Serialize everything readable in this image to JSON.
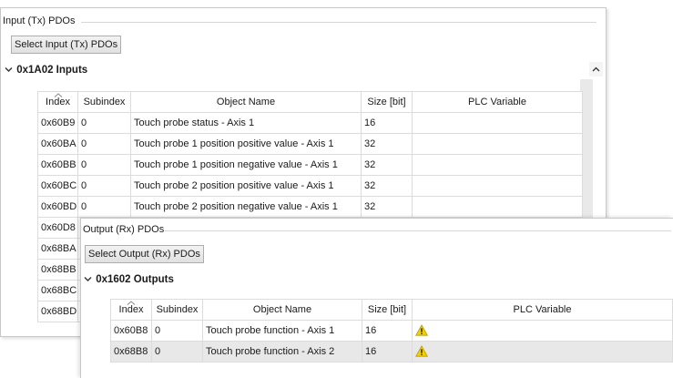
{
  "input_panel": {
    "group_title": "Input (Tx) PDOs",
    "select_button": "Select Input (Tx) PDOs",
    "section_title": "0x1A02 Inputs",
    "columns": [
      "Index",
      "Subindex",
      "Object Name",
      "Size [bit]",
      "PLC Variable"
    ],
    "rows": [
      {
        "index": "0x60B9",
        "subindex": "0",
        "name": "Touch probe status - Axis 1",
        "size": "16",
        "plc": ""
      },
      {
        "index": "0x60BA",
        "subindex": "0",
        "name": "Touch probe 1 position positive value - Axis 1",
        "size": "32",
        "plc": ""
      },
      {
        "index": "0x60BB",
        "subindex": "0",
        "name": "Touch probe 1 position negative value - Axis 1",
        "size": "32",
        "plc": ""
      },
      {
        "index": "0x60BC",
        "subindex": "0",
        "name": "Touch probe 2 position positive value - Axis 1",
        "size": "32",
        "plc": ""
      },
      {
        "index": "0x60BD",
        "subindex": "0",
        "name": "Touch probe 2 position negative value - Axis 1",
        "size": "32",
        "plc": ""
      },
      {
        "index": "0x60D8",
        "subindex": "",
        "name": "",
        "size": "",
        "plc": ""
      },
      {
        "index": "0x68BA",
        "subindex": "",
        "name": "",
        "size": "",
        "plc": ""
      },
      {
        "index": "0x68BB",
        "subindex": "",
        "name": "",
        "size": "",
        "plc": ""
      },
      {
        "index": "0x68BC",
        "subindex": "",
        "name": "",
        "size": "",
        "plc": ""
      },
      {
        "index": "0x68BD",
        "subindex": "",
        "name": "",
        "size": "",
        "plc": ""
      }
    ]
  },
  "output_panel": {
    "group_title": "Output (Rx) PDOs",
    "select_button": "Select Output (Rx) PDOs",
    "section_title": "0x1602 Outputs",
    "columns": [
      "Index",
      "Subindex",
      "Object Name",
      "Size [bit]",
      "PLC Variable"
    ],
    "rows": [
      {
        "index": "0x60B8",
        "subindex": "0",
        "name": "Touch probe function - Axis 1",
        "size": "16",
        "plc_icon": "warning-icon"
      },
      {
        "index": "0x68B8",
        "subindex": "0",
        "name": "Touch probe function - Axis 2",
        "size": "16",
        "plc_icon": "warning-icon"
      }
    ]
  },
  "icons": {
    "collapse": "chevron-down-icon",
    "sort": "sort-up-icon",
    "scroll_up": "scroll-up-arrow-icon",
    "warning": "warning-icon"
  },
  "colors": {
    "warning_fill": "#f5d000",
    "selected_row": "#e8e8e8",
    "grid_line": "#dcdcdc"
  }
}
